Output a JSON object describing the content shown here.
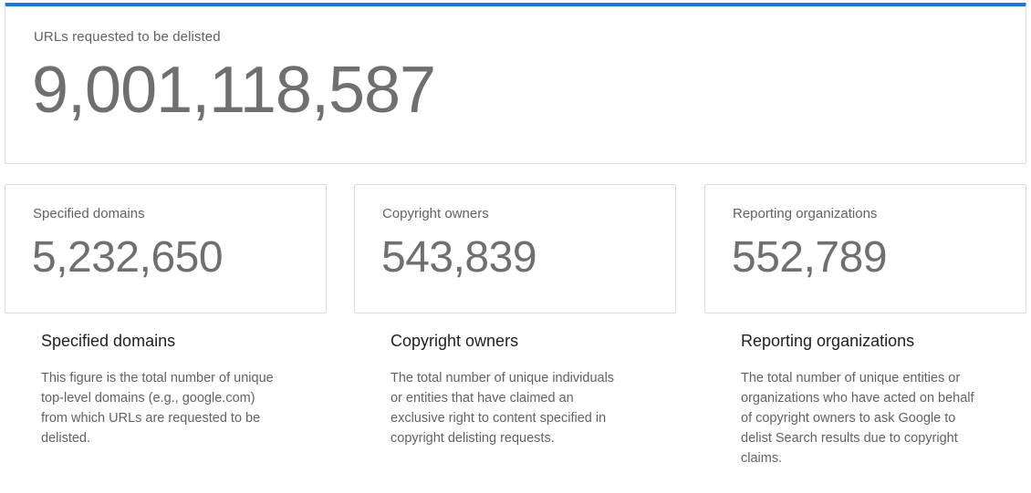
{
  "hero": {
    "label": "URLs requested to be delisted",
    "value": "9,001,118,587",
    "accent_color": "#1a73e8"
  },
  "stats": [
    {
      "label": "Specified domains",
      "value": "5,232,650"
    },
    {
      "label": "Copyright owners",
      "value": "543,839"
    },
    {
      "label": "Reporting organizations",
      "value": "552,789"
    }
  ],
  "descriptions": [
    {
      "title": "Specified domains",
      "lines": [
        "This figure is the total number of unique",
        "top-level domains (e.g., google.com)",
        "from which URLs are requested to be",
        "delisted."
      ]
    },
    {
      "title": "Copyright owners",
      "lines": [
        "The total number of unique individuals",
        "or entities that have claimed an",
        "exclusive right to content specified in",
        "copyright delisting requests."
      ]
    },
    {
      "title": "Reporting organizations",
      "lines": [
        "The total number of unique entities or",
        "organizations who have acted on behalf",
        "of copyright owners to ask Google to",
        "delist Search results due to copyright",
        "claims."
      ]
    }
  ]
}
